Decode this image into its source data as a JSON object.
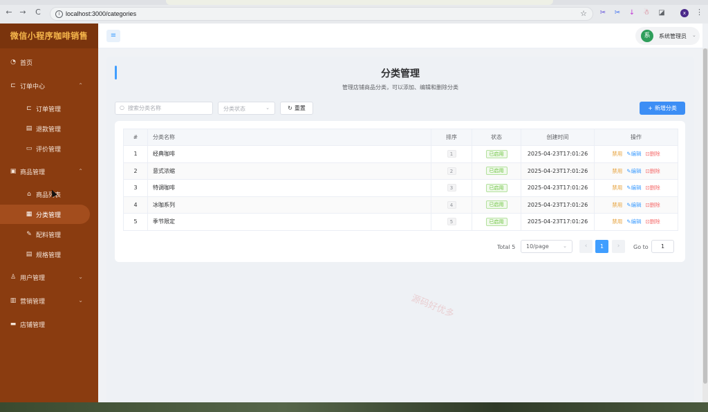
{
  "browser": {
    "url": "localhost:3000/categories",
    "nav": {
      "back": "←",
      "forward": "→",
      "reload": "C"
    },
    "extensions": [
      {
        "name": "scissors-ext-icon",
        "glyph": "✂",
        "color": "#5b48d9"
      },
      {
        "name": "scissors2-ext-icon",
        "glyph": "✂",
        "color": "#3a6df0"
      },
      {
        "name": "download-ext-icon",
        "glyph": "↓",
        "color": "#c23bd4"
      },
      {
        "name": "robot-ext-icon",
        "glyph": "☃",
        "color": "#d04a63"
      },
      {
        "name": "puzzle-ext-icon",
        "glyph": "◪",
        "color": "#5f6368"
      }
    ],
    "profile_initial": "x"
  },
  "sidebar": {
    "logo": "微信小程序咖啡销售",
    "items": [
      {
        "label": "首页",
        "icon": "◔",
        "icon_name": "dashboard-icon",
        "level": 0
      },
      {
        "label": "订单中心",
        "icon": "⊏",
        "icon_name": "cart-icon",
        "level": 0,
        "chevron": "⌃"
      },
      {
        "label": "订单管理",
        "icon": "⊏",
        "icon_name": "cart-icon",
        "level": 1
      },
      {
        "label": "退款管理",
        "icon": "▤",
        "icon_name": "refund-icon",
        "level": 1
      },
      {
        "label": "评价管理",
        "icon": "▭",
        "icon_name": "comment-icon",
        "level": 1
      },
      {
        "label": "商品管理",
        "icon": "▣",
        "icon_name": "bag-icon",
        "level": 0,
        "chevron": "⌃"
      },
      {
        "label": "商品列表",
        "icon": "⌂",
        "icon_name": "goods-icon",
        "level": 1
      },
      {
        "label": "分类管理",
        "icon": "▦",
        "icon_name": "grid-icon",
        "level": 1,
        "active": true
      },
      {
        "label": "配料管理",
        "icon": "✎",
        "icon_name": "ingredient-icon",
        "level": 1
      },
      {
        "label": "规格管理",
        "icon": "▤",
        "icon_name": "spec-icon",
        "level": 1
      },
      {
        "label": "用户管理",
        "icon": "♙",
        "icon_name": "user-icon",
        "level": 0,
        "chevron": "⌄"
      },
      {
        "label": "营销管理",
        "icon": "▥",
        "icon_name": "marketing-icon",
        "level": 0,
        "chevron": "⌄"
      },
      {
        "label": "店铺管理",
        "icon": "▬",
        "icon_name": "store-icon",
        "level": 0
      }
    ]
  },
  "header": {
    "menu_toggle": "≡",
    "avatar_text": "系",
    "user_name": "系统管理员",
    "user_chevron": "⌄"
  },
  "page": {
    "title": "分类管理",
    "subtitle": "管理店铺商品分类，可以添加、编辑和删除分类",
    "search_placeholder": "搜索分类名称",
    "status_placeholder": "分类状态",
    "reset_label": "重置",
    "add_label": "新增分类"
  },
  "table": {
    "headers": [
      "#",
      "分类名称",
      "排序",
      "状态",
      "创建时间",
      "操作"
    ],
    "rows": [
      {
        "idx": "1",
        "name": "经典咖啡",
        "sort": "1",
        "status": "已启用",
        "created": "2025-04-23T17:01:26"
      },
      {
        "idx": "2",
        "name": "意式浓缩",
        "sort": "2",
        "status": "已启用",
        "created": "2025-04-23T17:01:26"
      },
      {
        "idx": "3",
        "name": "特调咖啡",
        "sort": "3",
        "status": "已启用",
        "created": "2025-04-23T17:01:26"
      },
      {
        "idx": "4",
        "name": "冰咖系列",
        "sort": "4",
        "status": "已启用",
        "created": "2025-04-23T17:01:26"
      },
      {
        "idx": "5",
        "name": "季节限定",
        "sort": "5",
        "status": "已启用",
        "created": "2025-04-23T17:01:26"
      }
    ],
    "actions": {
      "disable": "禁用",
      "edit": "编辑",
      "delete": "删除"
    }
  },
  "pagination": {
    "total": "Total 5",
    "page_size": "10/page",
    "prev": "‹",
    "next": "›",
    "current": "1",
    "goto_label": "Go to",
    "goto_value": "1"
  },
  "watermark": "源码好优多",
  "colors": {
    "sidebar": "#8a3c10",
    "logo": "#f6b64b",
    "primary": "#409eff",
    "success": "#67c23a",
    "warning": "#e6a23c",
    "danger": "#f56c6c"
  }
}
